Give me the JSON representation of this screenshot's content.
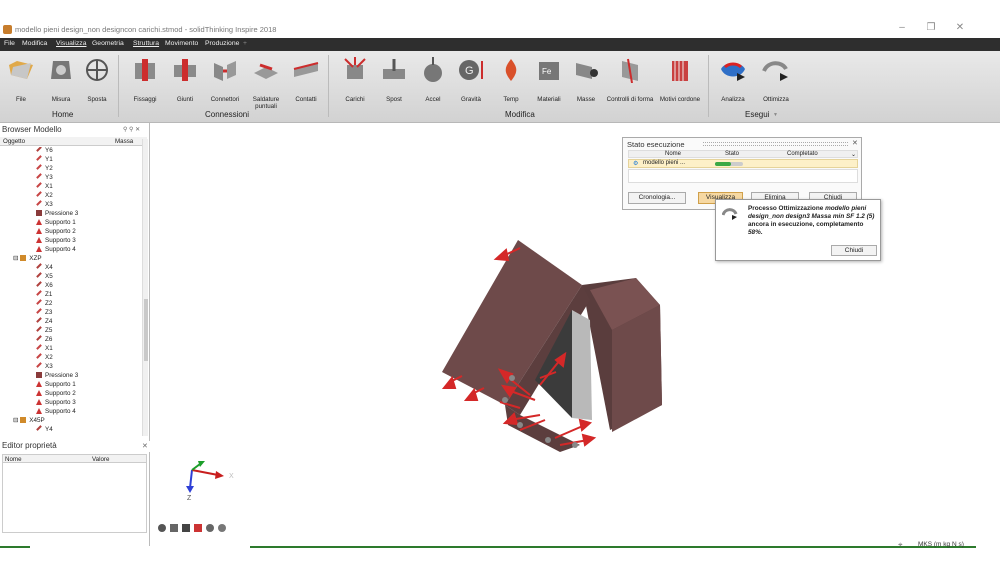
{
  "window": {
    "title": "modello pieni design_non designcon carichi.stmod - solidThinking Inspire 2018"
  },
  "menu": [
    "File",
    "Modifica",
    "Visualizza",
    "Geometria",
    "Struttura",
    "Movimento",
    "Produzione",
    "+"
  ],
  "ribbon": {
    "buttons": [
      {
        "label": "File",
        "icon": "folder-icon"
      },
      {
        "label": "Misura",
        "icon": "measure-icon"
      },
      {
        "label": "Sposta",
        "icon": "move-icon"
      },
      {
        "label": "Fissaggi",
        "icon": "fasteners-icon"
      },
      {
        "label": "Giunti",
        "icon": "joints-icon"
      },
      {
        "label": "Connettori",
        "icon": "connectors-icon"
      },
      {
        "label": "Saldature puntuali",
        "icon": "spot-welds-icon"
      },
      {
        "label": "Contatti",
        "icon": "contacts-icon"
      },
      {
        "label": "Carichi",
        "icon": "loads-icon"
      },
      {
        "label": "Spost",
        "icon": "displacement-icon"
      },
      {
        "label": "Accel",
        "icon": "acceleration-icon"
      },
      {
        "label": "Gravità",
        "icon": "gravity-icon"
      },
      {
        "label": "Temp",
        "icon": "temperature-icon"
      },
      {
        "label": "Materiali",
        "icon": "materials-icon"
      },
      {
        "label": "Masse",
        "icon": "masses-icon"
      },
      {
        "label": "Controlli di forma",
        "icon": "shape-controls-icon"
      },
      {
        "label": "Motivi cordone",
        "icon": "bead-patterns-icon"
      },
      {
        "label": "Analizza",
        "icon": "analyze-icon"
      },
      {
        "label": "Ottimizza",
        "icon": "optimize-icon"
      }
    ],
    "groups": [
      "Home",
      "Connessioni",
      "Modifica",
      "Esegui"
    ],
    "esegui_arrow": "▼"
  },
  "browser": {
    "title": "Browser Modello",
    "controls": "⚲ ⚲ ✕",
    "col_object": "Oggetto",
    "col_mass": "Massa",
    "items": [
      {
        "label": "Y6",
        "icon": "line"
      },
      {
        "label": "Y1",
        "icon": "arrow"
      },
      {
        "label": "Y2",
        "icon": "arrow"
      },
      {
        "label": "Y3",
        "icon": "arrow"
      },
      {
        "label": "X1",
        "icon": "arrow"
      },
      {
        "label": "X2",
        "icon": "arrow"
      },
      {
        "label": "X3",
        "icon": "arrow"
      },
      {
        "label": "Pressione 3",
        "icon": "pressure"
      },
      {
        "label": "Supporto 1",
        "icon": "support"
      },
      {
        "label": "Supporto 2",
        "icon": "support"
      },
      {
        "label": "Supporto 3",
        "icon": "support"
      },
      {
        "label": "Supporto 4",
        "icon": "support"
      },
      {
        "label": "XZP",
        "icon": "group",
        "toggle": "⊟"
      },
      {
        "label": "X4",
        "icon": "line"
      },
      {
        "label": "X5",
        "icon": "line"
      },
      {
        "label": "X6",
        "icon": "line"
      },
      {
        "label": "Z1",
        "icon": "arrow"
      },
      {
        "label": "Z2",
        "icon": "arrow"
      },
      {
        "label": "Z3",
        "icon": "arrow"
      },
      {
        "label": "Z4",
        "icon": "line"
      },
      {
        "label": "Z5",
        "icon": "line"
      },
      {
        "label": "Z6",
        "icon": "line"
      },
      {
        "label": "X1",
        "icon": "arrow"
      },
      {
        "label": "X2",
        "icon": "arrow"
      },
      {
        "label": "X3",
        "icon": "arrow"
      },
      {
        "label": "Pressione 3",
        "icon": "pressure"
      },
      {
        "label": "Supporto 1",
        "icon": "support"
      },
      {
        "label": "Supporto 2",
        "icon": "support"
      },
      {
        "label": "Supporto 3",
        "icon": "support"
      },
      {
        "label": "Supporto 4",
        "icon": "support"
      },
      {
        "label": "X45P",
        "icon": "group",
        "toggle": "⊟"
      },
      {
        "label": "Y4",
        "icon": "line"
      }
    ]
  },
  "properties": {
    "title": "Editor proprietà",
    "close": "✕",
    "col_name": "Nome",
    "col_value": "Valore"
  },
  "axes": {
    "z": "Z",
    "x": "X"
  },
  "status": {
    "units": "MKS (m kg N s)"
  },
  "run_status": {
    "title": "Stato esecuzione",
    "close": "✕",
    "cols": [
      "Nome",
      "Stato",
      "Completato"
    ],
    "row_name": "modello pieni ...",
    "progress": 0.58,
    "buttons": [
      "Cronologia...",
      "Visualizza",
      "Elimina",
      "Chiudi"
    ]
  },
  "popup": {
    "text_a": "Processo Ottimizzazione ",
    "text_b": "modello pieni design_non design3 Massa min SF 1.2 (5)",
    "text_c": " ancora in esecuzione, completamento ",
    "text_d": "58%",
    "text_e": ".",
    "close": "Chiudi"
  },
  "colors": {
    "part": "#6e4a4a",
    "load": "#d42828",
    "accent": "#1e7bd6"
  }
}
